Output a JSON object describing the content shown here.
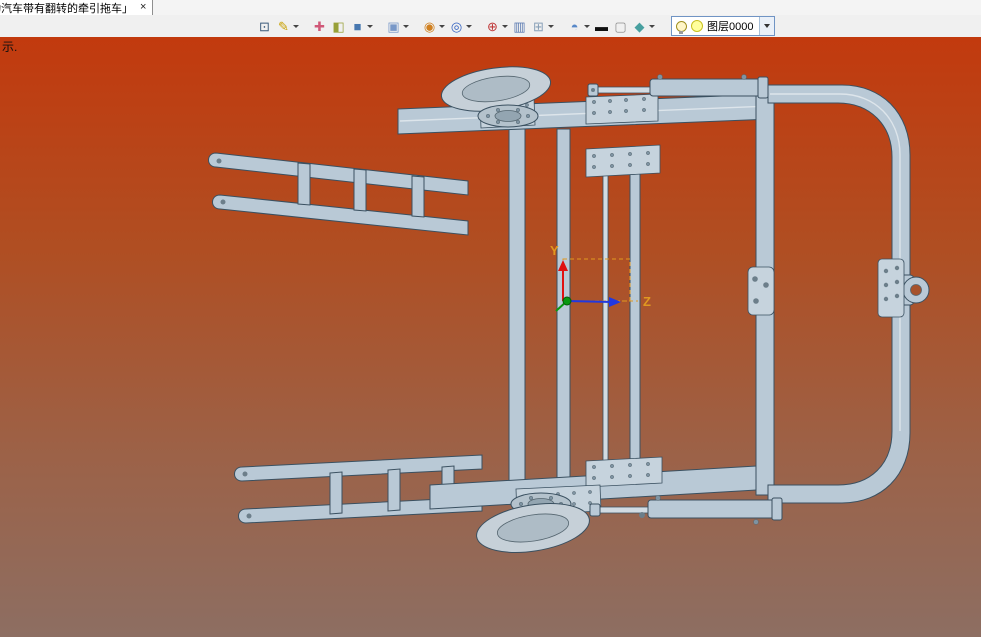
{
  "window": {
    "tab_title": "动汽车带有翻转的牵引拖车」",
    "tab_close": "×"
  },
  "viewport": {
    "corner_text": "示."
  },
  "toolbar": {
    "layer": {
      "label": "图层0000"
    },
    "icons": [
      {
        "name": "open-drawing-icon",
        "glyph": "⊡",
        "color": "#3a5a7a"
      },
      {
        "name": "pen-style-icon",
        "glyph": "✎",
        "color": "#c8a000",
        "dropdown": true
      },
      {
        "name": "pin-tool-icon",
        "glyph": "✚",
        "color": "#d05878",
        "gap_before": true
      },
      {
        "name": "face-style-icon",
        "glyph": "◧",
        "color": "#98a038"
      },
      {
        "name": "solid-cube-icon",
        "glyph": "■",
        "color": "#4878b0",
        "dropdown": true
      },
      {
        "name": "display-box-icon",
        "glyph": "▣",
        "color": "#7898c8",
        "dropdown": true,
        "gap_before": true
      },
      {
        "name": "color-wheel-icon",
        "glyph": "◉",
        "color": "#d08020",
        "dropdown": true,
        "gap_before": true
      },
      {
        "name": "zoom-icon",
        "glyph": "◎",
        "color": "#3060c0",
        "dropdown": true
      },
      {
        "name": "target-icon",
        "glyph": "⊕",
        "color": "#c03838",
        "dropdown": true,
        "gap_before": true
      },
      {
        "name": "image-icon",
        "glyph": "▥",
        "color": "#5878b0"
      },
      {
        "name": "grid-plane-icon",
        "glyph": "⊞",
        "color": "#88a0b8",
        "dropdown": true
      },
      {
        "name": "render-sphere-icon",
        "glyph": "◓",
        "color": "#5888c8",
        "dropdown": true,
        "gap_before": true
      },
      {
        "name": "line-width-icon",
        "glyph": "▬",
        "color": "#101010"
      },
      {
        "name": "color-swatch-icon",
        "glyph": "▢",
        "color": "#909090"
      },
      {
        "name": "material-view-icon",
        "glyph": "◆",
        "color": "#48a0a0",
        "dropdown": true
      }
    ]
  },
  "triad": {
    "y_label": "Y",
    "z_label": "Z"
  },
  "model": {
    "description": "3D CAD model of a trailer / tow cart frame with two wheels, hydraulic cylinders and curved drawbar with tow ring"
  },
  "colors": {
    "viewport_top": "#c23a0e",
    "viewport_bottom": "#8d6e62",
    "frame": "#b9c9d6",
    "frame_outline": "#3a5060",
    "wheel": "#c6d0d8",
    "axis_y": "#e01010",
    "axis_z": "#2038e0",
    "axis_origin": "#089810",
    "axis_label": "#e09820"
  }
}
